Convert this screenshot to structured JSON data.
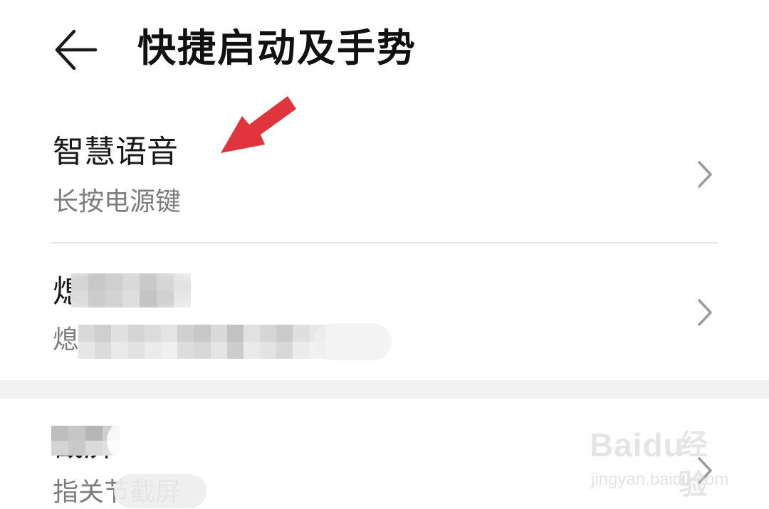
{
  "header": {
    "title": "快捷启动及手势"
  },
  "items": [
    {
      "title": "智慧语音",
      "subtitle": "长按电源键"
    },
    {
      "title": "熄",
      "subtitle": "熄"
    },
    {
      "title": "截屏",
      "subtitle": "指关节截屏"
    }
  ],
  "watermark": {
    "brand": "Baidu",
    "jingyan": "经验",
    "url": "jingyan.baidu.com"
  },
  "colors": {
    "annotation_arrow": "#e0353d",
    "divider": "#e2e2e2",
    "secondary_text": "#7d7d7d"
  },
  "icons": {
    "back": "arrow-left-icon",
    "chevron": "chevron-right-icon"
  }
}
